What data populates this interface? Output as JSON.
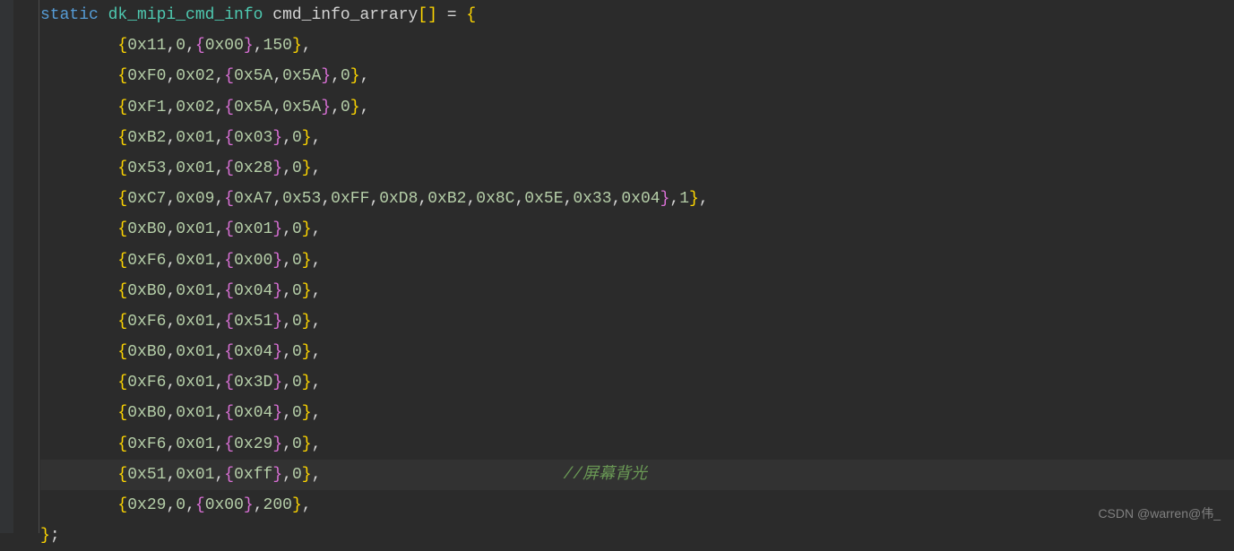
{
  "declaration": {
    "keyword": "static",
    "type": "dk_mipi_cmd_info",
    "identifier": "cmd_info_arrary",
    "brackets": "[]",
    "equals": " = ",
    "open_brace": "{"
  },
  "lines": [
    {
      "a": "0x11",
      "b": "0",
      "c": [
        "0x00"
      ],
      "d": "150"
    },
    {
      "a": "0xF0",
      "b": "0x02",
      "c": [
        "0x5A",
        "0x5A"
      ],
      "d": "0"
    },
    {
      "a": "0xF1",
      "b": "0x02",
      "c": [
        "0x5A",
        "0x5A"
      ],
      "d": "0"
    },
    {
      "a": "0xB2",
      "b": "0x01",
      "c": [
        "0x03"
      ],
      "d": "0"
    },
    {
      "a": "0x53",
      "b": "0x01",
      "c": [
        "0x28"
      ],
      "d": "0"
    },
    {
      "a": "0xC7",
      "b": "0x09",
      "c": [
        "0xA7",
        "0x53",
        "0xFF",
        "0xD8",
        "0xB2",
        "0x8C",
        "0x5E",
        "0x33",
        "0x04"
      ],
      "d": "1"
    },
    {
      "a": "0xB0",
      "b": "0x01",
      "c": [
        "0x01"
      ],
      "d": "0"
    },
    {
      "a": "0xF6",
      "b": "0x01",
      "c": [
        "0x00"
      ],
      "d": "0"
    },
    {
      "a": "0xB0",
      "b": "0x01",
      "c": [
        "0x04"
      ],
      "d": "0"
    },
    {
      "a": "0xF6",
      "b": "0x01",
      "c": [
        "0x51"
      ],
      "d": "0"
    },
    {
      "a": "0xB0",
      "b": "0x01",
      "c": [
        "0x04"
      ],
      "d": "0"
    },
    {
      "a": "0xF6",
      "b": "0x01",
      "c": [
        "0x3D"
      ],
      "d": "0"
    },
    {
      "a": "0xB0",
      "b": "0x01",
      "c": [
        "0x04"
      ],
      "d": "0"
    },
    {
      "a": "0xF6",
      "b": "0x01",
      "c": [
        "0x29"
      ],
      "d": "0"
    },
    {
      "a": "0x51",
      "b": "0x01",
      "c": [
        "0xff"
      ],
      "d": "0",
      "comment": "//屏幕背光",
      "highlight": true
    },
    {
      "a": "0x29",
      "b": "0",
      "c": [
        "0x00"
      ],
      "d": "200"
    }
  ],
  "close": {
    "brace": "}",
    "semicolon": ";"
  },
  "watermark": "CSDN @warren@伟_"
}
